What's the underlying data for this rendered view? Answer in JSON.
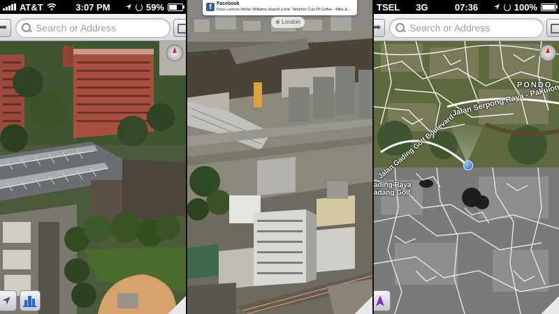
{
  "panels": [
    {
      "status": {
        "carrier": "AT&T",
        "network": "",
        "time": "3:07 PM",
        "battery": "59%",
        "battery_fraction": 0.59
      },
      "search": {
        "placeholder": "Search or Address"
      }
    },
    {
      "notification": {
        "app": "Facebook",
        "message": "Rose Lennon Weller Williams shared a link: \"Another Cup Of Coffee - Mike &..."
      },
      "location_chip": "London"
    },
    {
      "status": {
        "carrier": "TSEL",
        "network": "3G",
        "time": "07:36",
        "battery": "100%",
        "battery_fraction": 1.0
      },
      "search": {
        "placeholder": "Search or Address"
      },
      "map_labels": {
        "road1": "Jalan Serpong Raya - Pakulon",
        "road2": "Jalan Gading Golf Boulevard",
        "area1": "PONDO",
        "area2a": "ading Raya",
        "area2b": "adang Golf"
      }
    }
  ],
  "colors": {
    "location_blue": "#1463d6",
    "facebook_blue": "#3b5998",
    "compass_red": "#d22222"
  },
  "icons": [
    "back-arrow-icon",
    "search-icon",
    "bookmark-icon",
    "compass-icon",
    "location-arrow-icon",
    "3d-buildings-icon",
    "page-curl-icon",
    "facebook-icon"
  ]
}
